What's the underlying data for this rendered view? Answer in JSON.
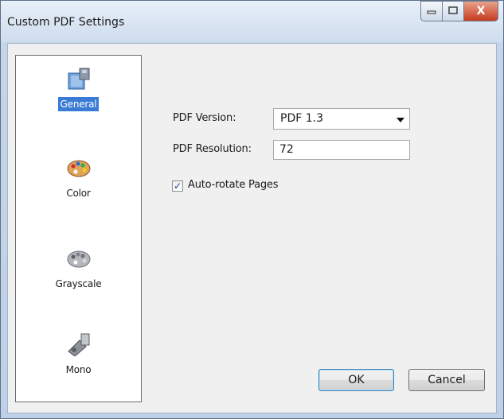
{
  "window": {
    "title": "Custom PDF Settings"
  },
  "caption": {
    "minimize": "▭",
    "maximize": "▢",
    "close": "X"
  },
  "sidebar": {
    "items": [
      {
        "label": "General",
        "icon": "general-settings-icon",
        "selected": true
      },
      {
        "label": "Color",
        "icon": "color-palette-icon",
        "selected": false
      },
      {
        "label": "Grayscale",
        "icon": "grayscale-palette-icon",
        "selected": false
      },
      {
        "label": "Mono",
        "icon": "mono-icon",
        "selected": false
      }
    ]
  },
  "general": {
    "pdf_version_label": "PDF Version:",
    "pdf_version_value": "PDF 1.3",
    "pdf_resolution_label": "PDF Resolution:",
    "pdf_resolution_value": "72",
    "auto_rotate_label": "Auto-rotate Pages",
    "auto_rotate_checked": true,
    "check_mark": "✓"
  },
  "buttons": {
    "ok": "OK",
    "cancel": "Cancel"
  },
  "colors": {
    "selection": "#3a7bd5",
    "title_bar": "#cedcee",
    "close_button": "#c63a20"
  }
}
